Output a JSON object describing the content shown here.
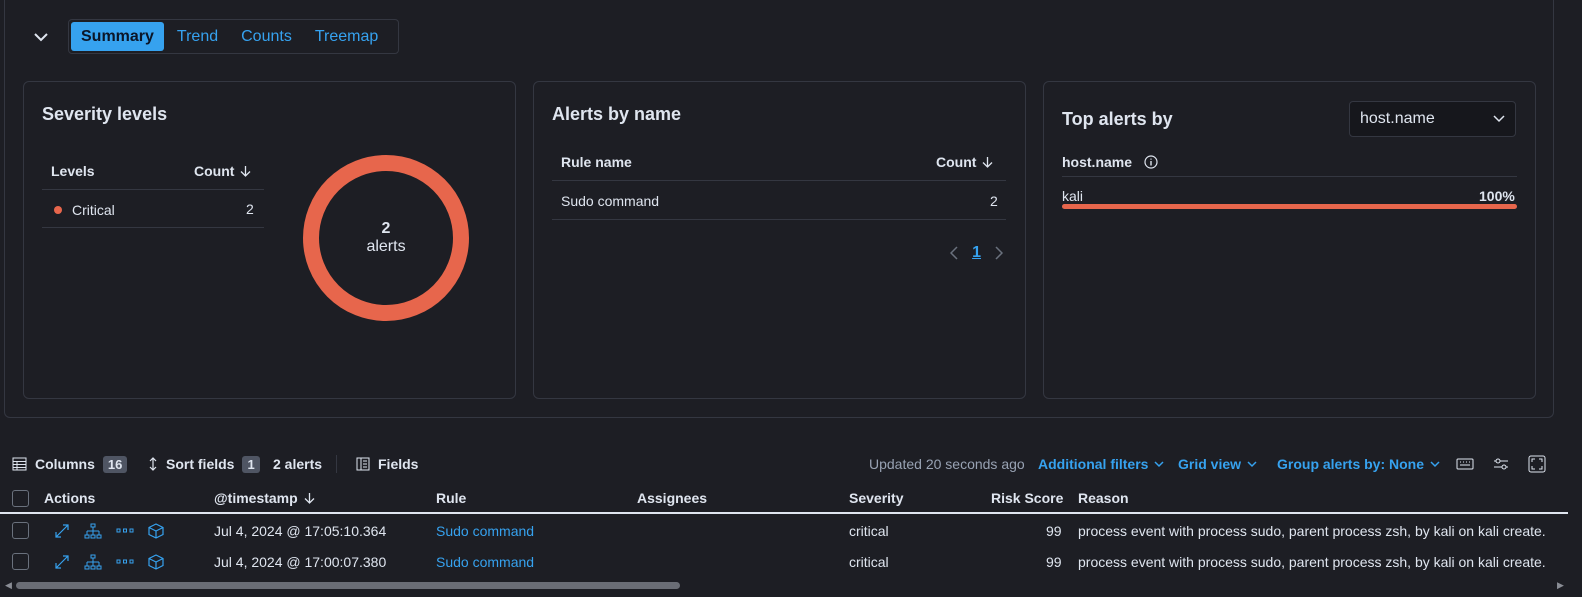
{
  "tabs": [
    "Summary",
    "Trend",
    "Counts",
    "Treemap"
  ],
  "severity": {
    "title": "Severity levels",
    "col_levels": "Levels",
    "col_count": "Count",
    "rows": [
      {
        "level": "Critical",
        "count": "2"
      }
    ],
    "donut_count": "2",
    "donut_label": "alerts",
    "colors": {
      "critical": "#e7664c"
    }
  },
  "alerts_by_name": {
    "title": "Alerts by name",
    "col_rule": "Rule name",
    "col_count": "Count",
    "rows": [
      {
        "name": "Sudo command",
        "count": "2"
      }
    ],
    "page": "1"
  },
  "top_alerts": {
    "title": "Top alerts by",
    "select_value": "host.name",
    "field_header": "host.name",
    "rows": [
      {
        "name": "kali",
        "percent_label": "100%",
        "fraction": 1.0
      }
    ]
  },
  "toolbar": {
    "columns_label": "Columns",
    "columns_count": "16",
    "sort_label": "Sort fields",
    "sort_count": "1",
    "alerts_count": "2 alerts",
    "fields_label": "Fields",
    "updated": "Updated 20 seconds ago",
    "additional_filters": "Additional filters",
    "grid_view": "Grid view",
    "group_by": "Group alerts by: None"
  },
  "grid": {
    "headers": {
      "actions": "Actions",
      "timestamp": "@timestamp",
      "rule": "Rule",
      "assignees": "Assignees",
      "severity": "Severity",
      "risk": "Risk Score",
      "reason": "Reason"
    },
    "rows": [
      {
        "timestamp": "Jul 4, 2024 @ 17:05:10.364",
        "rule": "Sudo command",
        "assignees": "",
        "severity": "critical",
        "risk": "99",
        "reason": "process event with process sudo, parent process zsh, by kali on kali create."
      },
      {
        "timestamp": "Jul 4, 2024 @ 17:00:07.380",
        "rule": "Sudo command",
        "assignees": "",
        "severity": "critical",
        "risk": "99",
        "reason": "process event with process sudo, parent process zsh, by kali on kali create."
      }
    ]
  },
  "icons": [
    "chevron-down-icon",
    "arrow-down-icon",
    "info-icon",
    "chevron-left-icon",
    "chevron-right-icon",
    "table-icon",
    "sort-icon",
    "fields-icon",
    "keyboard-icon",
    "settings-sliders-icon",
    "fullscreen-icon",
    "expand-icon",
    "analyze-tree-icon",
    "more-dots-icon",
    "cube-icon"
  ]
}
